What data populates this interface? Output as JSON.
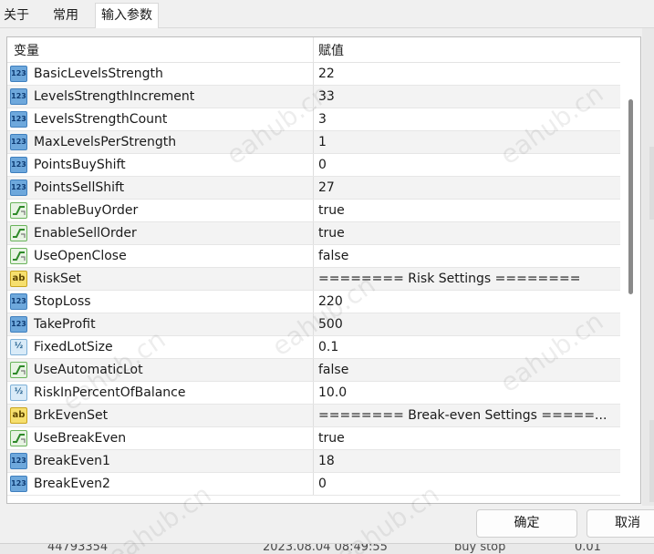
{
  "tabs": [
    {
      "label": "关于"
    },
    {
      "label": "常用"
    },
    {
      "label": "输入参数"
    }
  ],
  "grid": {
    "col_variable": "变量",
    "col_value": "赋值",
    "rows": [
      {
        "icon": "number-icon",
        "name": "BasicLevelsStrength",
        "value": "22"
      },
      {
        "icon": "number-icon",
        "name": "LevelsStrengthIncrement",
        "value": "33"
      },
      {
        "icon": "number-icon",
        "name": "LevelsStrengthCount",
        "value": "3"
      },
      {
        "icon": "number-icon",
        "name": "MaxLevelsPerStrength",
        "value": "1"
      },
      {
        "icon": "number-icon",
        "name": "PointsBuyShift",
        "value": "0"
      },
      {
        "icon": "number-icon",
        "name": "PointsSellShift",
        "value": "27"
      },
      {
        "icon": "boolean-icon",
        "name": "EnableBuyOrder",
        "value": "true"
      },
      {
        "icon": "boolean-icon",
        "name": "EnableSellOrder",
        "value": "true"
      },
      {
        "icon": "boolean-icon",
        "name": "UseOpenClose",
        "value": "false"
      },
      {
        "icon": "string-icon",
        "name": "RiskSet",
        "value": "======== Risk Settings ========"
      },
      {
        "icon": "number-icon",
        "name": "StopLoss",
        "value": "220"
      },
      {
        "icon": "number-icon",
        "name": "TakeProfit",
        "value": "500"
      },
      {
        "icon": "double-icon",
        "name": "FixedLotSize",
        "value": "0.1"
      },
      {
        "icon": "boolean-icon",
        "name": "UseAutomaticLot",
        "value": "false"
      },
      {
        "icon": "double-icon",
        "name": "RiskInPercentOfBalance",
        "value": "10.0"
      },
      {
        "icon": "string-icon",
        "name": "BrkEvenSet",
        "value": "======== Break-even Settings =====..."
      },
      {
        "icon": "boolean-icon",
        "name": "UseBreakEven",
        "value": "true"
      },
      {
        "icon": "number-icon",
        "name": "BreakEven1",
        "value": "18"
      },
      {
        "icon": "number-icon",
        "name": "BreakEven2",
        "value": "0"
      }
    ]
  },
  "buttons": {
    "ok": "确定",
    "cancel": "取消"
  },
  "background_row": {
    "ticket": "44793354",
    "time": "2023.08.04 08:49:55",
    "type": "buy stop",
    "volume": "0.01"
  },
  "icon_glyphs": {
    "number": "123",
    "string": "ab",
    "double": "½"
  },
  "watermark": "eahub.cn",
  "colors": {
    "number_icon": "#6ea8dc",
    "boolean_icon": "#69b35b",
    "string_icon": "#f6df6e",
    "double_icon": "#d9ebf8"
  }
}
